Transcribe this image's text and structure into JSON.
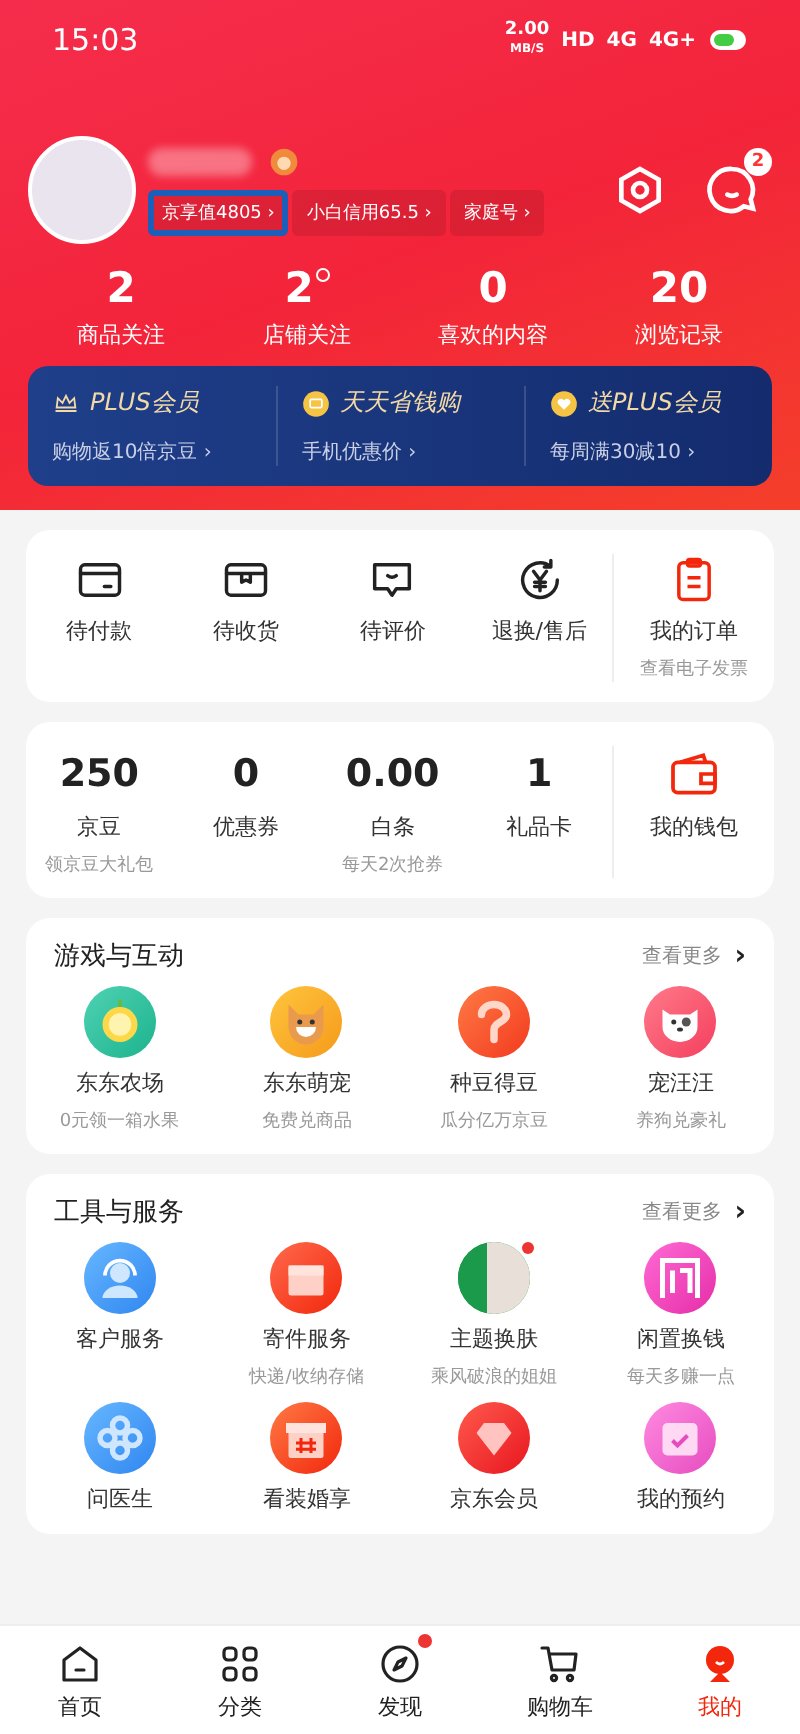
{
  "status_bar": {
    "time": "15:03",
    "speed": "2.00",
    "speed_unit": "MB/S",
    "networks": [
      "HD",
      "4G",
      "4G+"
    ]
  },
  "profile": {
    "badges": [
      {
        "label": "京享值4805 ›",
        "highlighted": true
      },
      {
        "label": "小白信用65.5 ›",
        "highlighted": false
      },
      {
        "label": "家庭号 ›",
        "highlighted": false
      }
    ],
    "message_count": "2"
  },
  "stats": [
    {
      "value": "2",
      "dot": false,
      "label": "商品关注"
    },
    {
      "value": "2",
      "dot": true,
      "label": "店铺关注"
    },
    {
      "value": "0",
      "dot": false,
      "label": "喜欢的内容"
    },
    {
      "value": "20",
      "dot": false,
      "label": "浏览记录"
    }
  ],
  "plus_banner": [
    {
      "kind": "crown",
      "title": "PLUS会员",
      "subtitle": "购物返10倍京豆 ›"
    },
    {
      "kind": "coin",
      "title": "天天省钱购",
      "subtitle": "手机优惠价 ›"
    },
    {
      "kind": "heart",
      "title": "送PLUS会员",
      "subtitle": "每周满30减10 ›"
    }
  ],
  "orders": {
    "items": [
      {
        "kind": "card",
        "label": "待付款"
      },
      {
        "kind": "box",
        "label": "待收货"
      },
      {
        "kind": "chat",
        "label": "待评价"
      },
      {
        "kind": "refund",
        "label": "退换/售后"
      }
    ],
    "main": {
      "label": "我的订单",
      "subtitle": "查看电子发票"
    }
  },
  "wallet": {
    "items": [
      {
        "value": "250",
        "label": "京豆",
        "subtitle": "领京豆大礼包"
      },
      {
        "value": "0",
        "label": "优惠券"
      },
      {
        "value": "0.00",
        "label": "白条",
        "subtitle": "每天2次抢券"
      },
      {
        "value": "1",
        "label": "礼品卡"
      }
    ],
    "main": {
      "label": "我的钱包"
    }
  },
  "games": {
    "title": "游戏与互动",
    "more": "查看更多",
    "more_arrow": "›",
    "items": [
      {
        "kind": "apple",
        "name": "东东农场",
        "subtitle": "0元领一箱水果"
      },
      {
        "kind": "dog",
        "name": "东东萌宠",
        "subtitle": "免费兑商品"
      },
      {
        "kind": "bean",
        "name": "种豆得豆",
        "subtitle": "瓜分亿万京豆"
      },
      {
        "kind": "puppy",
        "name": "宠汪汪",
        "subtitle": "养狗兑豪礼"
      }
    ]
  },
  "tools": {
    "title": "工具与服务",
    "more": "查看更多",
    "more_arrow": "›",
    "items": [
      {
        "kind": "headset",
        "name": "客户服务",
        "dot": false
      },
      {
        "kind": "parcel",
        "name": "寄件服务",
        "subtitle": "快递/收纳存储",
        "dot": false
      },
      {
        "kind": "photo",
        "name": "主题换肤",
        "subtitle": "乘风破浪的姐姐",
        "dot": true
      },
      {
        "kind": "idle",
        "name": "闲置换钱",
        "subtitle": "每天多赚一点",
        "dot": false
      },
      {
        "kind": "doctor",
        "name": "问医生",
        "dot": false
      },
      {
        "kind": "gift",
        "name": "看装婚享",
        "dot": false
      },
      {
        "kind": "gem",
        "name": "京东会员",
        "dot": false
      },
      {
        "kind": "calendar",
        "name": "我的预约",
        "dot": false
      }
    ]
  },
  "tab_bar": [
    {
      "kind": "home",
      "label": "首页",
      "selected": false,
      "dot": false
    },
    {
      "kind": "grid",
      "label": "分类",
      "selected": false,
      "dot": false
    },
    {
      "kind": "compass",
      "label": "发现",
      "selected": false,
      "dot": true
    },
    {
      "kind": "cart",
      "label": "购物车",
      "selected": false,
      "dot": false
    },
    {
      "kind": "mascot",
      "label": "我的",
      "selected": true,
      "dot": false
    }
  ]
}
